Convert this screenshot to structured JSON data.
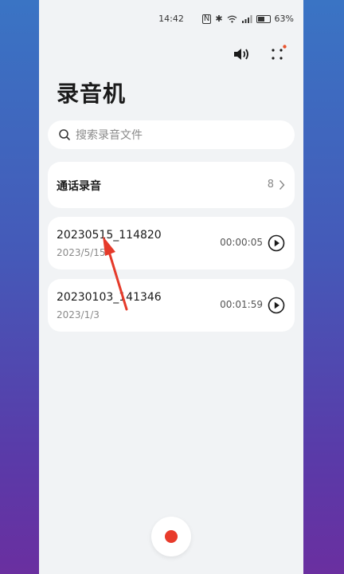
{
  "status_bar": {
    "time": "14:42",
    "battery": "63%"
  },
  "header": {
    "title": "录音机",
    "has_notification": true
  },
  "search": {
    "placeholder": "搜索录音文件"
  },
  "call_recordings": {
    "label": "通话录音",
    "count": "8"
  },
  "recordings": [
    {
      "name": "20230515_114820",
      "date": "2023/5/15",
      "duration": "00:00:05"
    },
    {
      "name": "20230103_141346",
      "date": "2023/1/3",
      "duration": "00:01:59"
    }
  ],
  "colors": {
    "record_dot": "#e83b2b",
    "annotation_arrow": "#e53a2a",
    "notification_dot": "#e8542e"
  },
  "icons": [
    "speaker-icon",
    "more-icon",
    "search-icon",
    "chevron-right-icon",
    "play-icon",
    "record-icon"
  ]
}
